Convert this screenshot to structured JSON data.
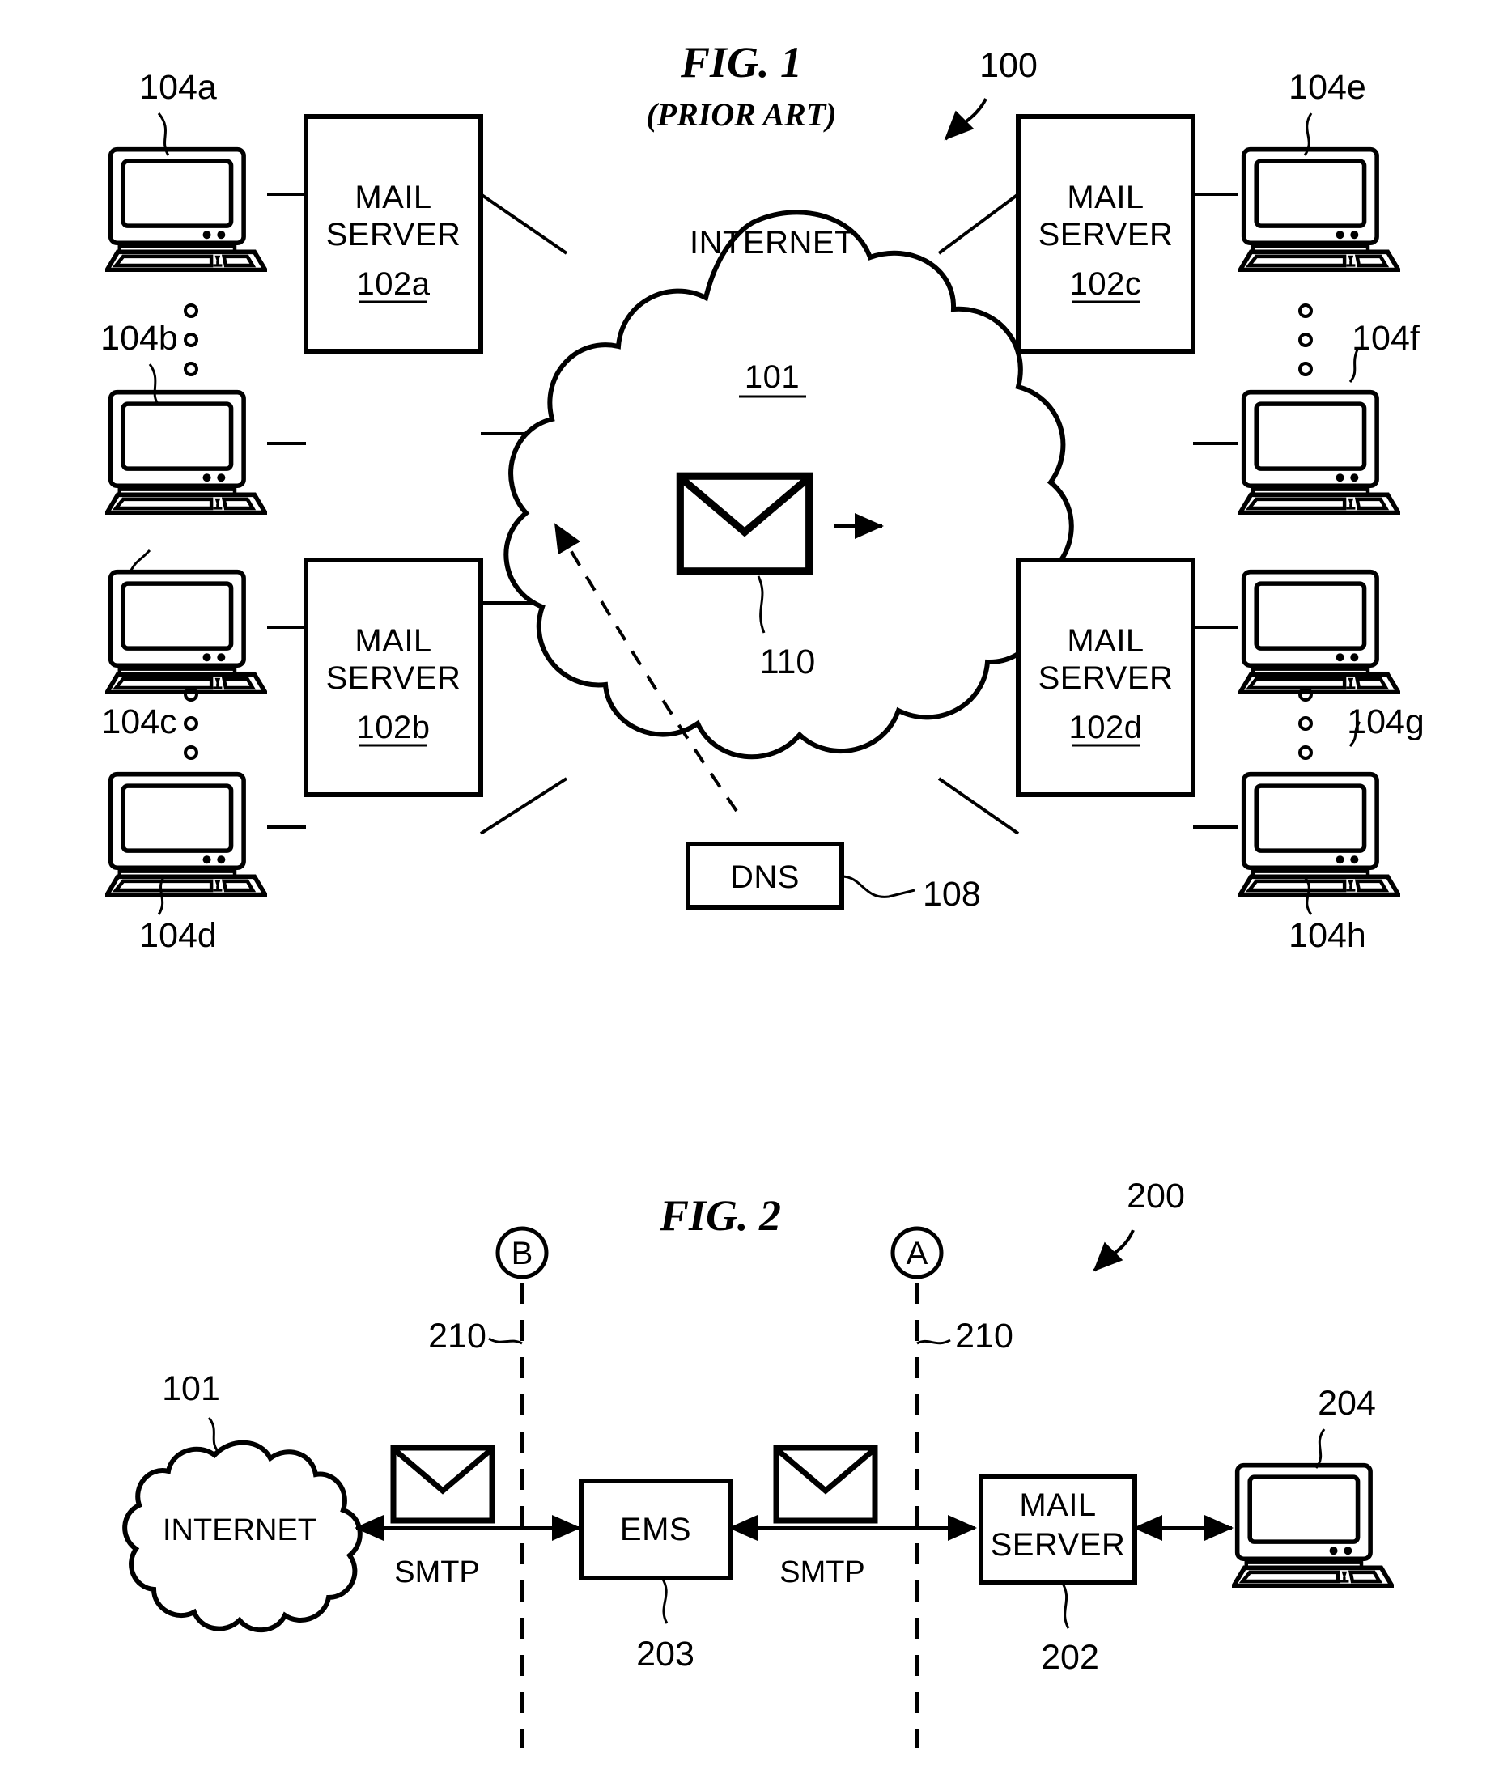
{
  "document": {
    "type": "patent-drawing-sheet",
    "figures": [
      {
        "id": "fig1",
        "title": "FIG. 1",
        "subtitle": "(PRIOR ART)",
        "reference": "100",
        "cloud": {
          "label": "INTERNET",
          "ref": "101"
        },
        "envelope": {
          "ref": "110"
        },
        "dns": {
          "label": "DNS",
          "ref": "108"
        },
        "servers": [
          {
            "line1": "MAIL",
            "line2": "SERVER",
            "ref": "102a"
          },
          {
            "line1": "MAIL",
            "line2": "SERVER",
            "ref": "102b"
          },
          {
            "line1": "MAIL",
            "line2": "SERVER",
            "ref": "102c"
          },
          {
            "line1": "MAIL",
            "line2": "SERVER",
            "ref": "102d"
          }
        ],
        "clients": [
          {
            "ref": "104a"
          },
          {
            "ref": "104b"
          },
          {
            "ref": "104c"
          },
          {
            "ref": "104d"
          },
          {
            "ref": "104e"
          },
          {
            "ref": "104f"
          },
          {
            "ref": "104g"
          },
          {
            "ref": "104h"
          }
        ]
      },
      {
        "id": "fig2",
        "title": "FIG. 2",
        "reference": "200",
        "cloud": {
          "label": "INTERNET",
          "ref": "101"
        },
        "markers": [
          {
            "letter": "B",
            "ref": "210"
          },
          {
            "letter": "A",
            "ref": "210"
          }
        ],
        "protocols": [
          {
            "label": "SMTP"
          },
          {
            "label": "SMTP"
          }
        ],
        "ems": {
          "label": "EMS",
          "ref": "203"
        },
        "mail_server": {
          "line1": "MAIL",
          "line2": "SERVER",
          "ref": "202"
        },
        "client": {
          "ref": "204"
        }
      }
    ]
  },
  "colors": {
    "ink": "#000000",
    "paper": "#ffffff"
  }
}
